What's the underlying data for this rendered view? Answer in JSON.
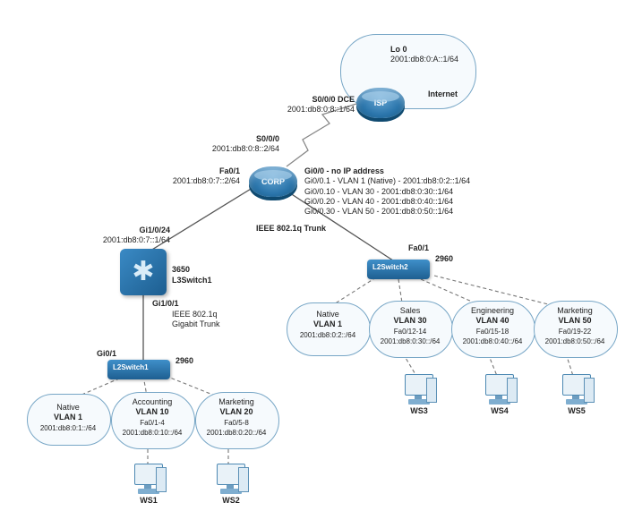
{
  "devices": {
    "isp": {
      "label": "ISP"
    },
    "corp": {
      "label": "CORP"
    },
    "l3switch1": {
      "model": "3650",
      "name": "L3Switch1"
    },
    "l2switch1": {
      "model": "2960",
      "name": "L2Switch1"
    },
    "l2switch2": {
      "model": "2960",
      "name": "L2Switch2"
    },
    "ws1": {
      "name": "WS1"
    },
    "ws2": {
      "name": "WS2"
    },
    "ws3": {
      "name": "WS3"
    },
    "ws4": {
      "name": "WS4"
    },
    "ws5": {
      "name": "WS5"
    }
  },
  "internet": {
    "title": "Internet",
    "lo0_label": "Lo 0",
    "lo0_addr": "2001:db8:0:A::1/64"
  },
  "links": {
    "isp_side": {
      "iface": "S0/0/0 DCE",
      "addr": "2001:db8:0:8::1/64"
    },
    "corp_s000": {
      "iface": "S0/0/0",
      "addr": "2001:db8:0:8::2/64"
    },
    "corp_fa01": {
      "iface": "Fa0/1",
      "addr": "2001:db8:0:7::2/64"
    },
    "corp_gi00": {
      "header": "Gi0/0 - no IP address",
      "sub1": "Gi0/0.1 - VLAN 1 (Native) - 2001:db8:0:2::1/64",
      "sub2": "Gi0/0.10 - VLAN 30 - 2001:db8:0:30::1/64",
      "sub3": "Gi0/0.20 - VLAN 40 - 2001:db8:0:40::1/64",
      "sub4": "Gi0/0.30 - VLAN 50 - 2001:db8:0:50::1/64"
    },
    "l3_gi1024": {
      "iface": "Gi1/0/24",
      "addr": "2001:db8:0:7::1/64"
    },
    "l3_gi101": {
      "iface": "Gi1/0/1",
      "note1": "IEEE 802.1q",
      "note2": "Gigabit Trunk"
    },
    "l2sw1_gi01": {
      "iface": "Gi0/1"
    },
    "trunk_right": {
      "label": "IEEE 802.1q Trunk"
    },
    "l2sw2_fa01": {
      "iface": "Fa0/1"
    }
  },
  "clouds": {
    "native1_left": {
      "title": "Native",
      "vlan": "VLAN 1",
      "addr": "2001:db8:0:1::/64"
    },
    "accounting": {
      "title": "Accounting",
      "vlan": "VLAN 10",
      "ports": "Fa0/1-4",
      "addr": "2001:db8:0:10::/64"
    },
    "marketing20": {
      "title": "Marketing",
      "vlan": "VLAN 20",
      "ports": "Fa0/5-8",
      "addr": "2001:db8:0:20::/64"
    },
    "native1_right": {
      "title": "Native",
      "vlan": "VLAN 1",
      "addr": "2001:db8:0:2::/64"
    },
    "sales": {
      "title": "Sales",
      "vlan": "VLAN 30",
      "ports": "Fa0/12-14",
      "addr": "2001:db8:0:30::/64"
    },
    "engineering": {
      "title": "Engineering",
      "vlan": "VLAN 40",
      "ports": "Fa0/15-18",
      "addr": "2001:db8:0:40::/64"
    },
    "marketing50": {
      "title": "Marketing",
      "vlan": "VLAN 50",
      "ports": "Fa0/19-22",
      "addr": "2001:db8:0:50::/64"
    }
  }
}
